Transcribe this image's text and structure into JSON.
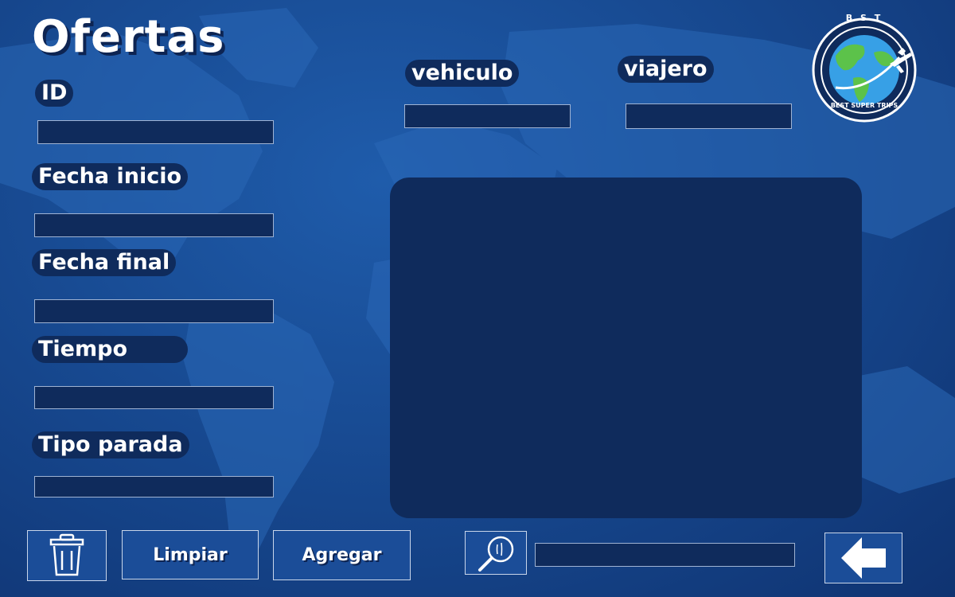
{
  "page": {
    "title": "Ofertas"
  },
  "form": {
    "id_label": "ID",
    "fecha_inicio_label": "Fecha inicio",
    "fecha_final_label": "Fecha final",
    "tiempo_label": "Tiempo",
    "tipo_parada_label": "Tipo parada",
    "vehiculo_label": "vehiculo",
    "viajero_label": "viajero",
    "values": {
      "id": "",
      "fecha_inicio": "",
      "fecha_final": "",
      "tiempo": "",
      "tipo_parada": "",
      "vehiculo": "",
      "viajero": ""
    }
  },
  "logo": {
    "top_text": "B S T",
    "bottom_text": "BEST SUPER TRIPS",
    "icon": "globe-airplane-icon"
  },
  "toolbar": {
    "delete_icon": "trash-icon",
    "limpiar_label": "Limpiar",
    "agregar_label": "Agregar",
    "search_icon": "search-icon",
    "search_value": "",
    "back_icon": "arrow-left-icon"
  },
  "colors": {
    "background": "#16468c",
    "field": "#0f2b5c",
    "panel": "#0f2b5c",
    "button": "#1b4d98"
  }
}
